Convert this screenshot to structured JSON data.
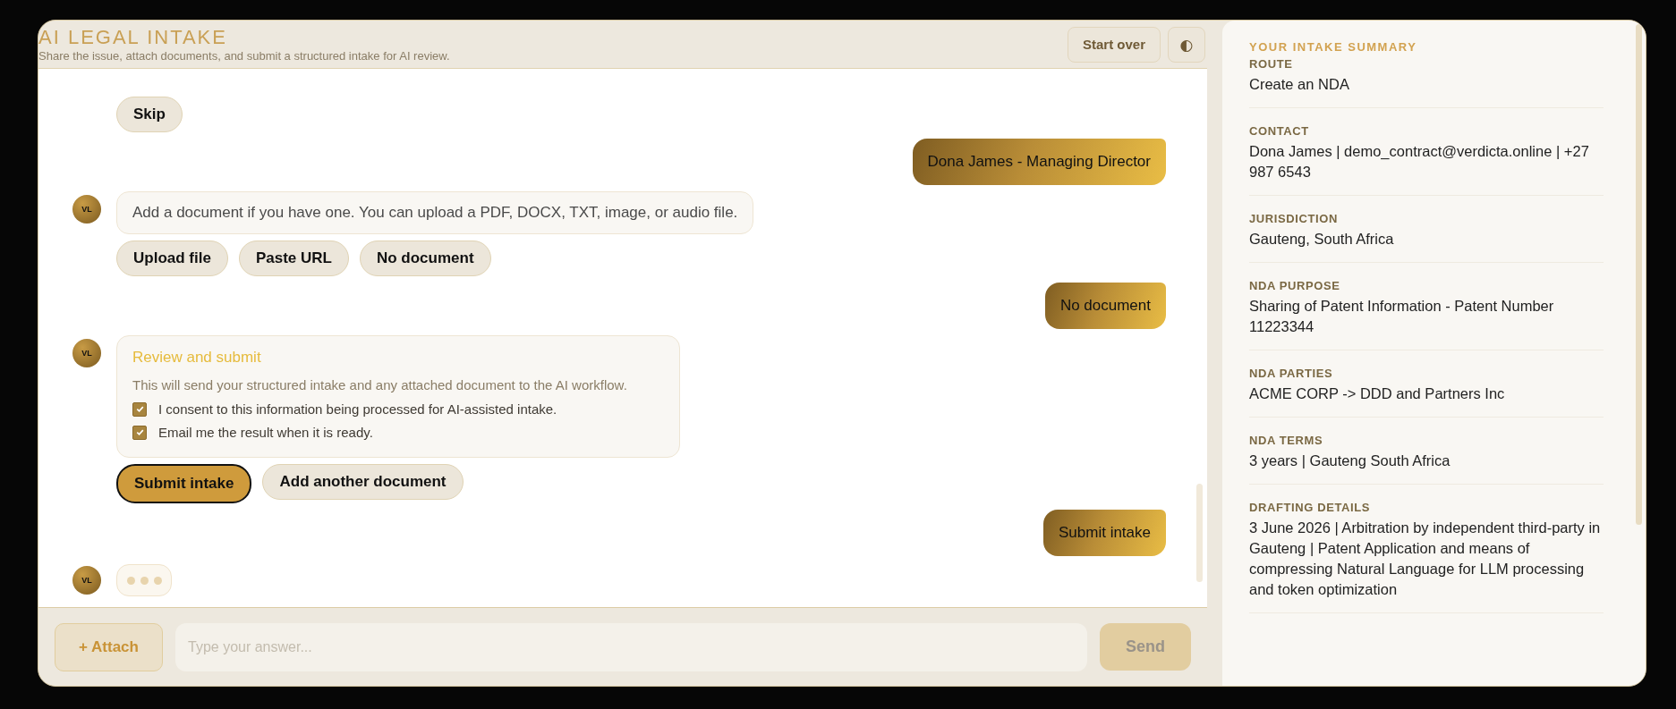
{
  "header": {
    "title": "AI LEGAL INTAKE",
    "subtitle": "Share the issue, attach documents, and submit a structured intake for AI review.",
    "start_over": "Start over",
    "theme_toggle": "◐"
  },
  "messages": [
    {
      "kind": "options",
      "buttons": [
        {
          "label": "Skip",
          "primary": false
        }
      ]
    },
    {
      "kind": "user",
      "text": "Dona James - Managing Director"
    },
    {
      "kind": "bot",
      "avatar": "VL",
      "text": "Add a document if you have one. You can upload a PDF, DOCX, TXT, image, or audio file."
    },
    {
      "kind": "options",
      "buttons": [
        {
          "label": "Upload file",
          "primary": false
        },
        {
          "label": "Paste URL",
          "primary": false
        },
        {
          "label": "No document",
          "primary": false
        }
      ]
    },
    {
      "kind": "user",
      "text": "No document"
    },
    {
      "kind": "review",
      "avatar": "VL",
      "title": "Review and submit",
      "description": "This will send your structured intake and any attached document to the AI workflow.",
      "checks": [
        {
          "label": "I consent to this information being processed for AI-assisted intake.",
          "checked": true
        },
        {
          "label": "Email me the result when it is ready.",
          "checked": true
        }
      ]
    },
    {
      "kind": "options",
      "buttons": [
        {
          "label": "Submit intake",
          "primary": true
        },
        {
          "label": "Add another document",
          "primary": false
        }
      ]
    },
    {
      "kind": "user",
      "text": "Submit intake"
    },
    {
      "kind": "typing",
      "avatar": "VL"
    }
  ],
  "composer": {
    "attach": "+ Attach",
    "placeholder": "Type your answer...",
    "send": "Send",
    "send_disabled": true
  },
  "summary": {
    "title": "YOUR INTAKE SUMMARY",
    "items": [
      {
        "label": "ROUTE",
        "value": "Create an NDA"
      },
      {
        "label": "CONTACT",
        "value": "Dona James | demo_contract@verdicta.online | +27 987 6543"
      },
      {
        "label": "JURISDICTION",
        "value": "Gauteng, South Africa"
      },
      {
        "label": "NDA PURPOSE",
        "value": "Sharing of Patent Information - Patent Number 11223344"
      },
      {
        "label": "NDA PARTIES",
        "value": "ACME CORP -> DDD and Partners Inc"
      },
      {
        "label": "NDA TERMS",
        "value": "3 years | Gauteng South Africa"
      },
      {
        "label": "DRAFTING DETAILS",
        "value": "3 June 2026 | Arbitration by independent third-party in Gauteng | Patent Application and means of compressing Natural Language for LLM processing and token optimization"
      }
    ]
  }
}
